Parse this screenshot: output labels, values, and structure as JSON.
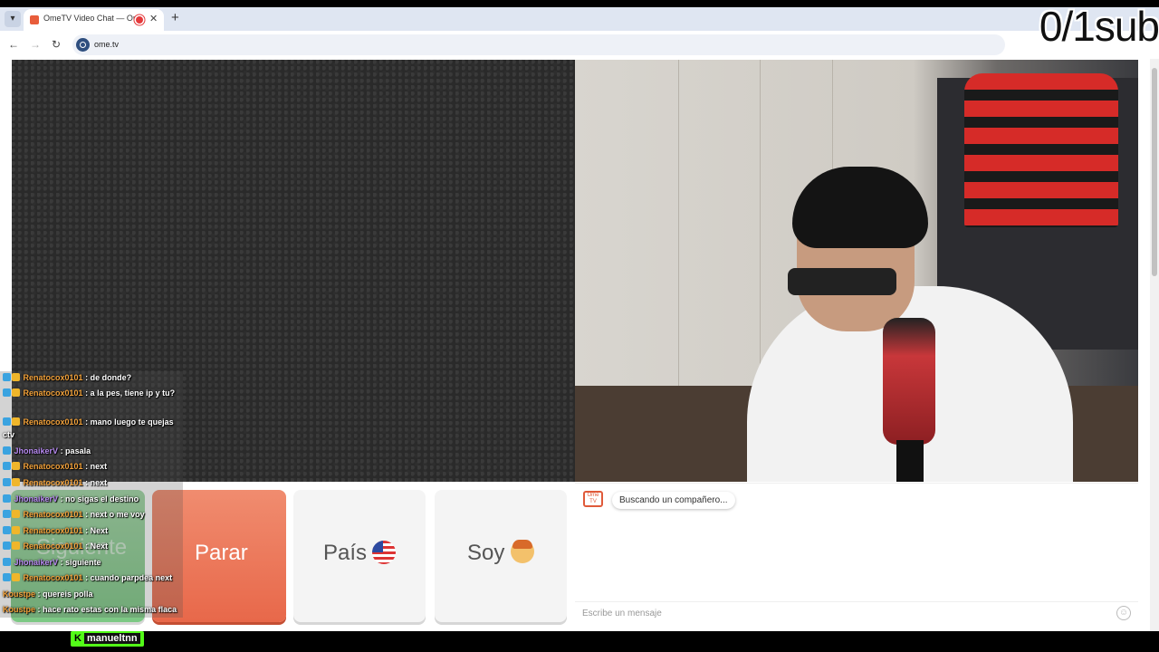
{
  "browser": {
    "tab_title": "OmeTV Video Chat — Ome",
    "tab_close": "✕",
    "new_tab": "+",
    "back": "←",
    "forward": "→",
    "reload": "↻",
    "url": "ome.tv"
  },
  "overlay": {
    "sub_counter": "0/1sub",
    "channel_name": "manueltnn",
    "kick_logo": "K"
  },
  "controls": {
    "start_label": "Siguiente",
    "stop_label": "Parar",
    "country_label": "País",
    "gender_label": "Soy"
  },
  "chat": {
    "status": "Buscando un compañero...",
    "logo_text": "Ome TV",
    "placeholder": "Escribe un mensaje"
  },
  "stream_chat": [
    {
      "user": "Renatocox0101",
      "text": ": de donde?"
    },
    {
      "user": "Renatocox0101",
      "text": ": a la pes, tiene ip y tu?"
    },
    {
      "user": "Renatocox0101",
      "text": ": mano luego te quejas ctv"
    },
    {
      "user": "JhonaikerV",
      "text": ": pasala"
    },
    {
      "user": "Renatocox0101",
      "text": ": next"
    },
    {
      "user": "Renatocox0101",
      "text": ": next"
    },
    {
      "user": "JhonaikerV",
      "text": ": no sigas el destino"
    },
    {
      "user": "Renatocox0101",
      "text": ": next o me voy"
    },
    {
      "user": "Renatocox0101",
      "text": ": Next"
    },
    {
      "user": "Renatocox0101",
      "text": ": Next"
    },
    {
      "user": "JhonaikerV",
      "text": ": siguiente"
    },
    {
      "user": "Renatocox0101",
      "text": ": cuando parpdea next"
    },
    {
      "user": "Koustpe",
      "text": ": quereis polla"
    },
    {
      "user": "Koustpe",
      "text": ": hace rato estas con la misma flaca"
    }
  ],
  "colors": {
    "accent_stop": "#e8684a",
    "accent_start": "#7cc884",
    "kick_green": "#53fc18"
  },
  "icons": {
    "country": "us-flag-icon",
    "gender": "boy-face-icon",
    "emoji": "smile-icon"
  }
}
